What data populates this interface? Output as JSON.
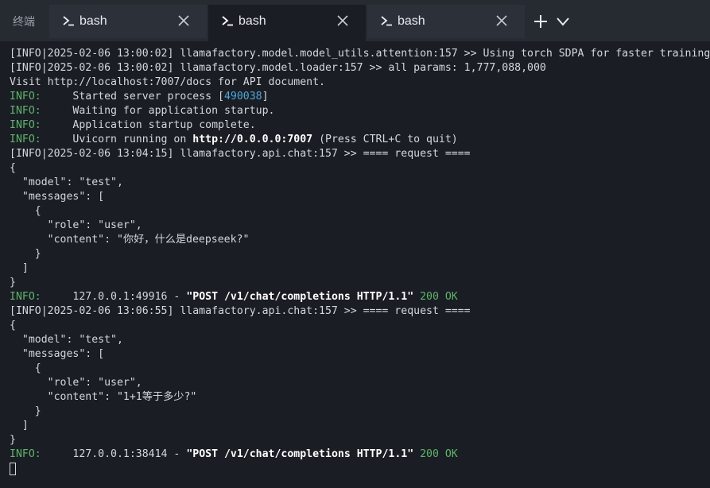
{
  "app": {
    "label": "终端"
  },
  "tabs": [
    {
      "title": "bash",
      "active": false
    },
    {
      "title": "bash",
      "active": true
    },
    {
      "title": "bash",
      "active": false
    }
  ],
  "icons": {
    "prompt": "terminal-prompt-icon",
    "close": "close-icon",
    "new_tab": "plus-icon",
    "dropdown": "chevron-down-icon"
  },
  "colors": {
    "background": "#1a1d23",
    "tabbar": "#262a31",
    "text": "#d4d7dc",
    "info_level": "#5fb46d",
    "pid": "#4ea8de"
  },
  "terminal": {
    "lines": [
      {
        "segments": [
          {
            "text": "[INFO|2025-02-06 13:00:02] llamafactory.model.model_utils.attention:157 >> Using torch SDPA for faster training"
          }
        ]
      },
      {
        "segments": [
          {
            "text": "[INFO|2025-02-06 13:00:02] llamafactory.model.loader:157 >> all params: 1,777,088,000"
          }
        ]
      },
      {
        "segments": [
          {
            "text": "Visit http://localhost:7007/docs for API document."
          }
        ]
      },
      {
        "segments": [
          {
            "text": "INFO:",
            "cls": "lvl"
          },
          {
            "text": "     Started server process ["
          },
          {
            "text": "490038",
            "cls": "pid"
          },
          {
            "text": "]"
          }
        ]
      },
      {
        "segments": [
          {
            "text": "INFO:",
            "cls": "lvl"
          },
          {
            "text": "     Waiting for application startup."
          }
        ]
      },
      {
        "segments": [
          {
            "text": "INFO:",
            "cls": "lvl"
          },
          {
            "text": "     Application startup complete."
          }
        ]
      },
      {
        "segments": [
          {
            "text": "INFO:",
            "cls": "lvl"
          },
          {
            "text": "     Uvicorn running on "
          },
          {
            "text": "http://0.0.0.0:7007",
            "cls": "bold"
          },
          {
            "text": " (Press CTRL+C to quit)"
          }
        ]
      },
      {
        "segments": [
          {
            "text": "[INFO|2025-02-06 13:04:15] llamafactory.api.chat:157 >> ==== request ===="
          }
        ]
      },
      {
        "segments": [
          {
            "text": "{"
          }
        ]
      },
      {
        "segments": [
          {
            "text": "  \"model\": \"test\","
          }
        ]
      },
      {
        "segments": [
          {
            "text": "  \"messages\": ["
          }
        ]
      },
      {
        "segments": [
          {
            "text": "    {"
          }
        ]
      },
      {
        "segments": [
          {
            "text": "      \"role\": \"user\","
          }
        ]
      },
      {
        "segments": [
          {
            "text": "      \"content\": \"你好，什么是deepseek?\""
          }
        ]
      },
      {
        "segments": [
          {
            "text": "    }"
          }
        ]
      },
      {
        "segments": [
          {
            "text": "  ]"
          }
        ]
      },
      {
        "segments": [
          {
            "text": "}"
          }
        ]
      },
      {
        "segments": [
          {
            "text": "INFO:",
            "cls": "lvl"
          },
          {
            "text": "     127.0.0.1:49916 - "
          },
          {
            "text": "\"POST /v1/chat/completions HTTP/1.1\"",
            "cls": "bold"
          },
          {
            "text": " "
          },
          {
            "text": "200 OK",
            "cls": "ok"
          }
        ]
      },
      {
        "segments": [
          {
            "text": "[INFO|2025-02-06 13:06:55] llamafactory.api.chat:157 >> ==== request ===="
          }
        ]
      },
      {
        "segments": [
          {
            "text": "{"
          }
        ]
      },
      {
        "segments": [
          {
            "text": "  \"model\": \"test\","
          }
        ]
      },
      {
        "segments": [
          {
            "text": "  \"messages\": ["
          }
        ]
      },
      {
        "segments": [
          {
            "text": "    {"
          }
        ]
      },
      {
        "segments": [
          {
            "text": "      \"role\": \"user\","
          }
        ]
      },
      {
        "segments": [
          {
            "text": "      \"content\": \"1+1等于多少?\""
          }
        ]
      },
      {
        "segments": [
          {
            "text": "    }"
          }
        ]
      },
      {
        "segments": [
          {
            "text": "  ]"
          }
        ]
      },
      {
        "segments": [
          {
            "text": "}"
          }
        ]
      },
      {
        "segments": [
          {
            "text": "INFO:",
            "cls": "lvl"
          },
          {
            "text": "     127.0.0.1:38414 - "
          },
          {
            "text": "\"POST /v1/chat/completions HTTP/1.1\"",
            "cls": "bold"
          },
          {
            "text": " "
          },
          {
            "text": "200 OK",
            "cls": "ok"
          }
        ]
      }
    ]
  }
}
